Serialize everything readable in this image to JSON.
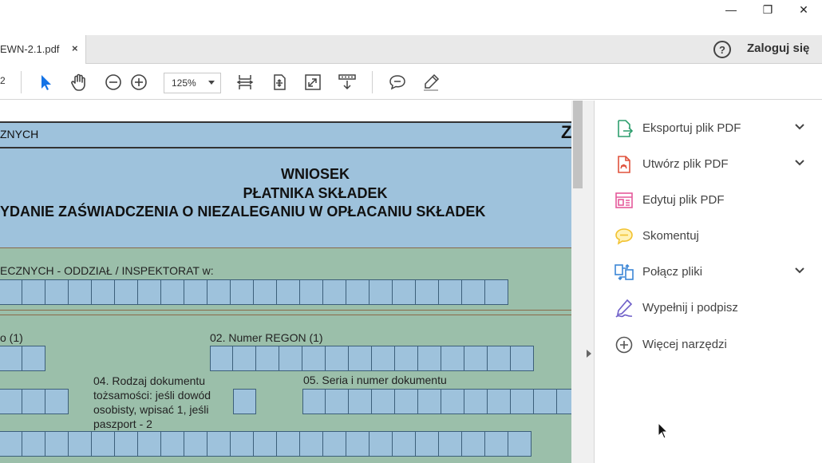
{
  "window": {
    "minimize_glyph": "—",
    "maximize_glyph": "❐",
    "close_glyph": "✕"
  },
  "tab": {
    "label": "EWN-2.1.pdf",
    "close_glyph": "×"
  },
  "header": {
    "help_glyph": "?",
    "login_label": "Zaloguj się"
  },
  "toolbar": {
    "page_number": "2",
    "zoom_value": "125%",
    "icons": [
      "select-arrow-icon",
      "hand-icon",
      "zoom-out-icon",
      "zoom-in-icon",
      "fit-width-icon",
      "fit-page-icon",
      "fullscreen-icon",
      "scroll-mode-icon",
      "comment-icon",
      "highlight-pen-icon"
    ]
  },
  "document": {
    "header_left": "ZNYCH",
    "header_right": "Z",
    "title_lines": [
      "WNIOSEK",
      "PŁATNIKA SKŁADEK",
      "YDANIE ZAŚWIADCZENIA O NIEZALEGANIU W OPŁACANIU SKŁADEK"
    ],
    "branch_label": "ECZNYCH - ODDZIAŁ / INSPEKTORAT w:",
    "field01_label": "o (1)",
    "field02_label": "02. Numer REGON (1)",
    "field04_label": "04. Rodzaj dokumentu tożsamości: jeśli dowód osobisty, wpisać 1, jeśli paszport - 2",
    "field05_label": "05. Seria i numer dokumentu"
  },
  "tools": [
    {
      "label": "Eksportuj plik PDF",
      "icon": "export-pdf-icon",
      "color": "#2e9e6e",
      "expandable": true
    },
    {
      "label": "Utwórz plik PDF",
      "icon": "create-pdf-icon",
      "color": "#e0523c",
      "expandable": true
    },
    {
      "label": "Edytuj plik PDF",
      "icon": "edit-pdf-icon",
      "color": "#e55a9b",
      "expandable": false
    },
    {
      "label": "Skomentuj",
      "icon": "comment-icon",
      "color": "#f2c230",
      "expandable": false
    },
    {
      "label": "Połącz pliki",
      "icon": "combine-files-icon",
      "color": "#3b86d6",
      "expandable": true
    },
    {
      "label": "Wypełnij i podpisz",
      "icon": "fill-sign-icon",
      "color": "#6e5ec8",
      "expandable": false
    },
    {
      "label": "Więcej narzędzi",
      "icon": "more-tools-icon",
      "color": "#555555",
      "expandable": false
    }
  ],
  "colors": {
    "header_band": "#9ec2dc",
    "form_green": "#9bbfaa",
    "input_box": "#9ec2dc",
    "toolbar_accent": "#1473e6"
  }
}
